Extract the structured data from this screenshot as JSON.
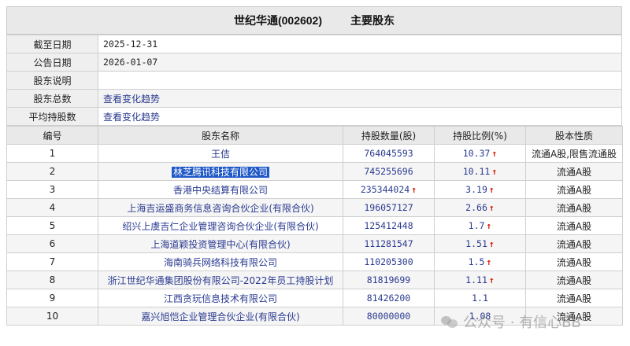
{
  "header": {
    "company": "世纪华通(002602)",
    "section": "主要股东"
  },
  "info": [
    {
      "key": "截至日期",
      "value": "2025-12-31",
      "link": false
    },
    {
      "key": "公告日期",
      "value": "2026-01-07",
      "link": false
    },
    {
      "key": "股东说明",
      "value": "",
      "link": false
    },
    {
      "key": "股东总数",
      "value": "查看变化趋势",
      "link": true
    },
    {
      "key": "平均持股数",
      "value": "查看变化趋势",
      "link": true
    }
  ],
  "table": {
    "columns": [
      "编号",
      "股东名称",
      "持股数量(股)",
      "持股比例(%)",
      "股本性质"
    ],
    "rows": [
      {
        "no": "1",
        "name": "王佶",
        "shares": "764045593",
        "shares_up": false,
        "ratio": "10.37",
        "ratio_up": true,
        "nature": "流通A股,限售流通股"
      },
      {
        "no": "2",
        "name": "林芝腾讯科技有限公司",
        "shares": "745255696",
        "shares_up": false,
        "ratio": "10.11",
        "ratio_up": true,
        "nature": "流通A股"
      },
      {
        "no": "3",
        "name": "香港中央结算有限公司",
        "shares": "235344024",
        "shares_up": true,
        "ratio": "3.19",
        "ratio_up": true,
        "nature": "流通A股"
      },
      {
        "no": "4",
        "name": "上海吉运盛商务信息咨询合伙企业(有限合伙)",
        "shares": "196057127",
        "shares_up": false,
        "ratio": "2.66",
        "ratio_up": true,
        "nature": "流通A股"
      },
      {
        "no": "5",
        "name": "绍兴上虞吉仁企业管理咨询合伙企业(有限合伙)",
        "shares": "125412448",
        "shares_up": false,
        "ratio": "1.7",
        "ratio_up": true,
        "nature": "流通A股"
      },
      {
        "no": "6",
        "name": "上海道颖投资管理中心(有限合伙)",
        "shares": "111281547",
        "shares_up": false,
        "ratio": "1.51",
        "ratio_up": true,
        "nature": "流通A股"
      },
      {
        "no": "7",
        "name": "海南骑兵网络科技有限公司",
        "shares": "110205300",
        "shares_up": false,
        "ratio": "1.5",
        "ratio_up": true,
        "nature": "流通A股"
      },
      {
        "no": "8",
        "name": "浙江世纪华通集团股份有限公司-2022年员工持股计划",
        "shares": "81819699",
        "shares_up": false,
        "ratio": "1.11",
        "ratio_up": true,
        "nature": "流通A股"
      },
      {
        "no": "9",
        "name": "江西贪玩信息技术有限公司",
        "shares": "81426200",
        "shares_up": false,
        "ratio": "1.1",
        "ratio_up": false,
        "nature": "流通A股"
      },
      {
        "no": "10",
        "name": "嘉兴旭恺企业管理合伙企业(有限合伙)",
        "shares": "80000000",
        "shares_up": false,
        "ratio": "1.08",
        "ratio_up": false,
        "nature": "流通A股"
      }
    ],
    "arrow": "↑"
  },
  "watermark": {
    "text": "公众号 · 有信心BB",
    "icon": "wechat-icon"
  },
  "colors": {
    "link": "#2a3a90",
    "up_arrow": "#d81e06",
    "selection": "#1e57c7"
  }
}
